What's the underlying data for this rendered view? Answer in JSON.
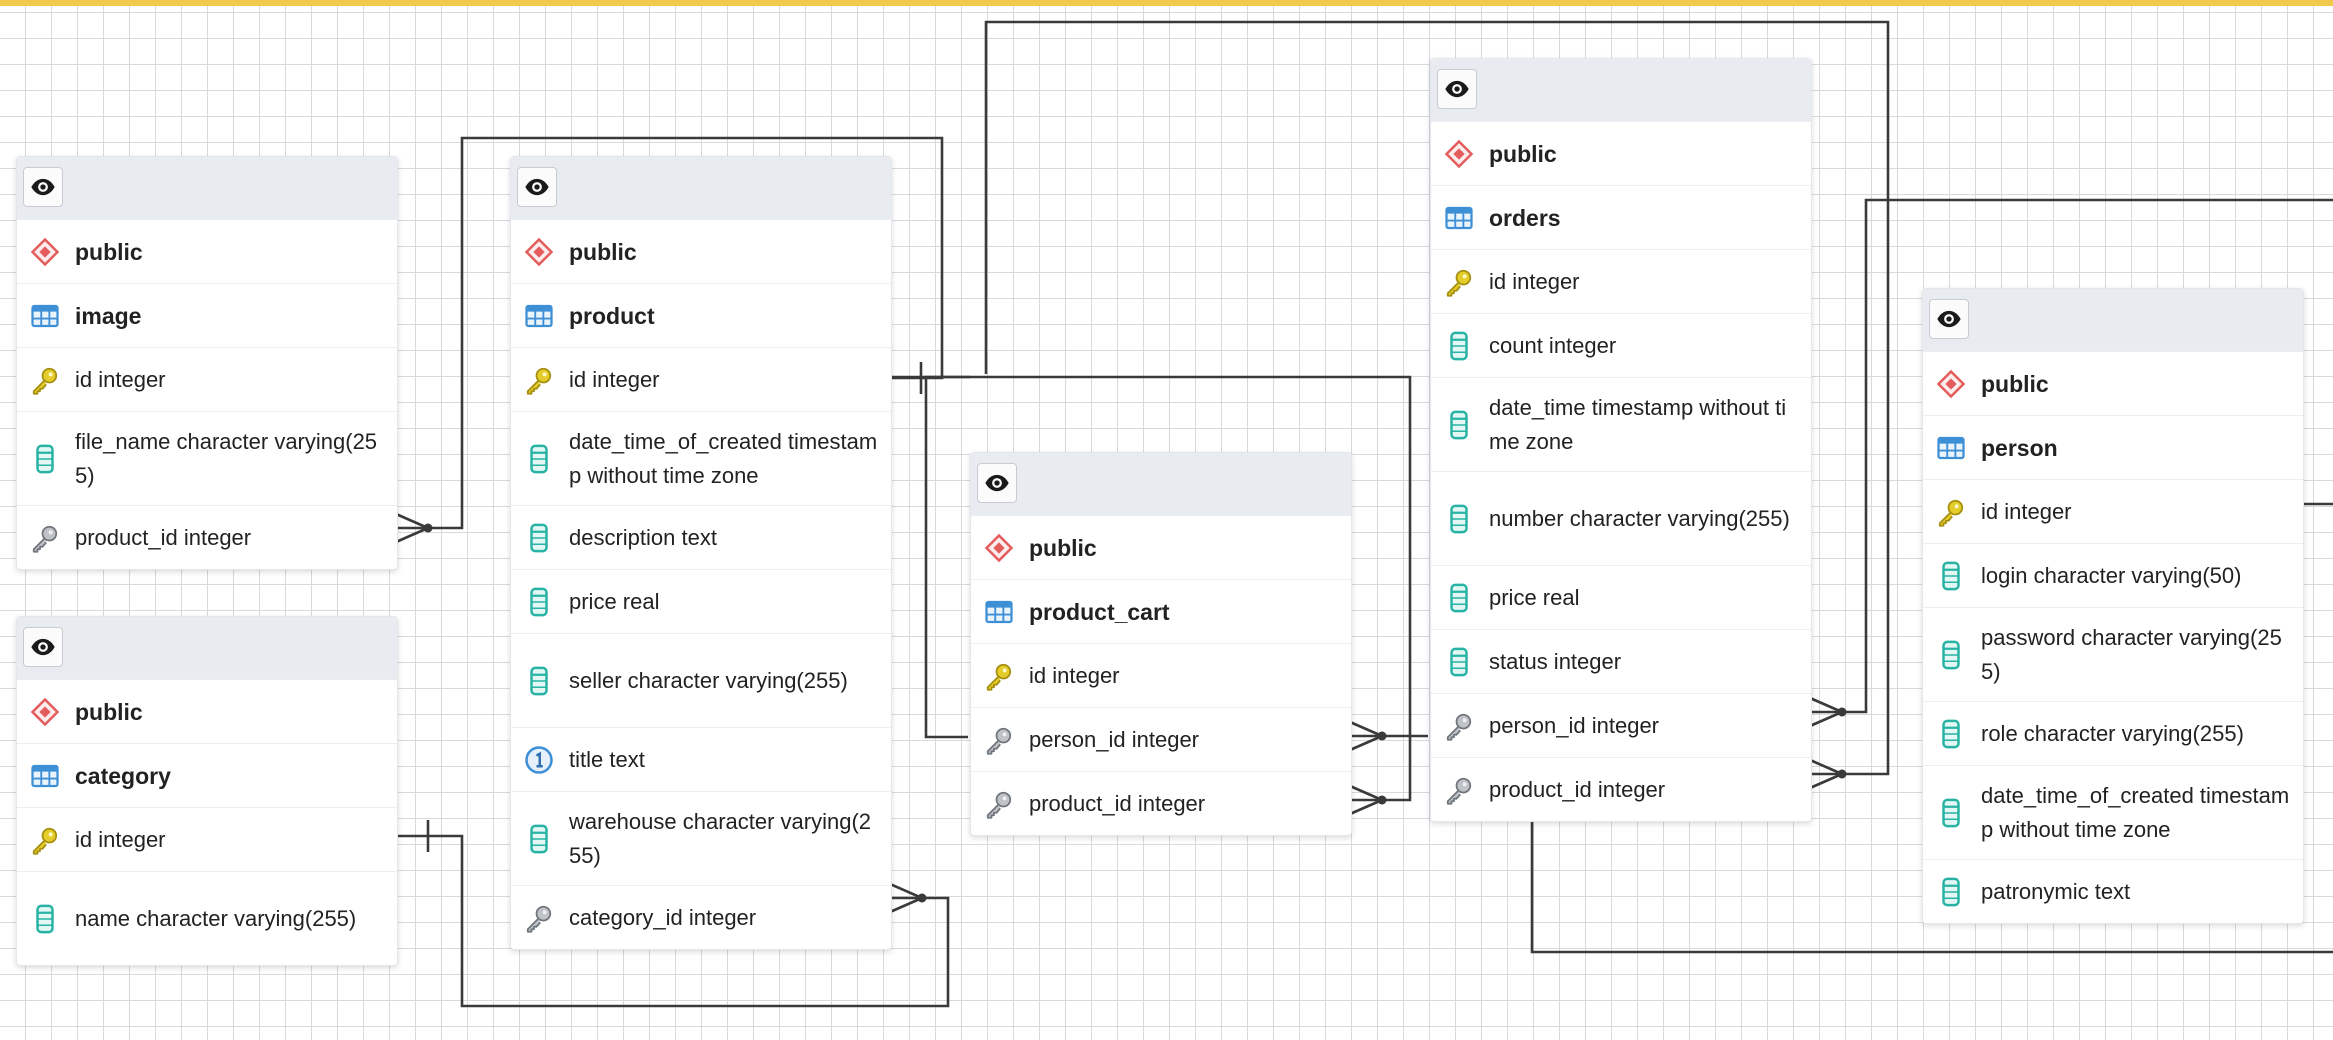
{
  "colors": {
    "background": "#ffffff",
    "grid": "#d6d9de",
    "top_bar": "#f2c94c",
    "header": "#e8ebf0",
    "schema_icon": "#e35d5d",
    "table_icon": "#3d8fd6",
    "key_icon": "#c9b21a",
    "column_icon": "#29b3a4",
    "connector": "#3a3a3a"
  },
  "tables": {
    "image": {
      "schema": "public",
      "name": "image",
      "columns": [
        {
          "text": "id integer",
          "icon": "key-icon"
        },
        {
          "text": "file_name character varying(255)",
          "icon": "column-icon"
        },
        {
          "text": "product_id integer",
          "icon": "foreign-key-icon"
        }
      ]
    },
    "category": {
      "schema": "public",
      "name": "category",
      "columns": [
        {
          "text": "id integer",
          "icon": "key-icon"
        },
        {
          "text": "name character varying(255)",
          "icon": "column-icon"
        }
      ]
    },
    "product": {
      "schema": "public",
      "name": "product",
      "columns": [
        {
          "text": "id integer",
          "icon": "key-icon"
        },
        {
          "text": "date_time_of_created timestamp without time zone",
          "icon": "column-icon"
        },
        {
          "text": "description text",
          "icon": "column-icon"
        },
        {
          "text": "price real",
          "icon": "column-icon"
        },
        {
          "text": "seller character varying(255)",
          "icon": "column-icon"
        },
        {
          "text": "title text",
          "icon": "unique-icon"
        },
        {
          "text": "warehouse character varying(255)",
          "icon": "column-icon"
        },
        {
          "text": "category_id integer",
          "icon": "foreign-key-icon"
        }
      ]
    },
    "product_cart": {
      "schema": "public",
      "name": "product_cart",
      "columns": [
        {
          "text": "id integer",
          "icon": "key-icon"
        },
        {
          "text": "person_id integer",
          "icon": "foreign-key-icon"
        },
        {
          "text": "product_id integer",
          "icon": "foreign-key-icon"
        }
      ]
    },
    "orders": {
      "schema": "public",
      "name": "orders",
      "columns": [
        {
          "text": "id integer",
          "icon": "key-icon"
        },
        {
          "text": "count integer",
          "icon": "column-icon"
        },
        {
          "text": "date_time timestamp without time zone",
          "icon": "column-icon"
        },
        {
          "text": "number character varying(255)",
          "icon": "column-icon"
        },
        {
          "text": "price real",
          "icon": "column-icon"
        },
        {
          "text": "status integer",
          "icon": "column-icon"
        },
        {
          "text": "person_id integer",
          "icon": "foreign-key-icon"
        },
        {
          "text": "product_id integer",
          "icon": "foreign-key-icon"
        }
      ]
    },
    "person": {
      "schema": "public",
      "name": "person",
      "columns": [
        {
          "text": "id integer",
          "icon": "key-icon"
        },
        {
          "text": "login character varying(50)",
          "icon": "column-icon"
        },
        {
          "text": "password character varying(255)",
          "icon": "column-icon"
        },
        {
          "text": "role character varying(255)",
          "icon": "column-icon"
        },
        {
          "text": "date_time_of_created timestamp without time zone",
          "icon": "column-icon"
        },
        {
          "text": "patronymic text",
          "icon": "column-icon"
        }
      ]
    }
  },
  "relations": [
    {
      "from": "image.product_id",
      "to": "product.id",
      "many_end": "image"
    },
    {
      "from": "product.category_id",
      "to": "category.id",
      "many_end": "product"
    },
    {
      "from": "product_cart.person_id",
      "to": "person.id",
      "many_end": "product_cart"
    },
    {
      "from": "product_cart.product_id",
      "to": "product.id",
      "many_end": "product_cart"
    },
    {
      "from": "orders.person_id",
      "to": "person.id",
      "many_end": "orders"
    },
    {
      "from": "orders.product_id",
      "to": "product.id",
      "many_end": "orders"
    }
  ]
}
